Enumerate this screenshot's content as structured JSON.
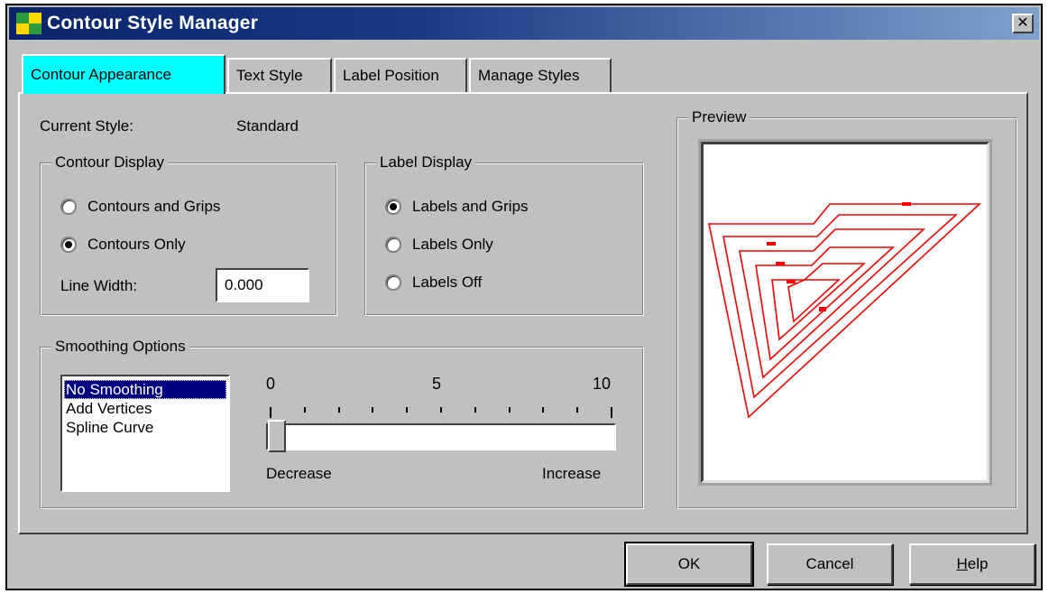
{
  "window": {
    "title": "Contour Style Manager",
    "close_label": "✕"
  },
  "tabs": [
    {
      "label": "Contour Appearance",
      "active": true
    },
    {
      "label": "Text Style",
      "active": false
    },
    {
      "label": "Label Position",
      "active": false
    },
    {
      "label": "Manage Styles",
      "active": false
    }
  ],
  "current_style": {
    "label": "Current Style:",
    "value": "Standard"
  },
  "contour_display": {
    "title": "Contour Display",
    "options": [
      {
        "label": "Contours and Grips",
        "checked": false
      },
      {
        "label": "Contours Only",
        "checked": true
      }
    ],
    "line_width_label": "Line Width:",
    "line_width_value": "0.000"
  },
  "label_display": {
    "title": "Label Display",
    "options": [
      {
        "label": "Labels and Grips",
        "checked": true
      },
      {
        "label": "Labels Only",
        "checked": false
      },
      {
        "label": "Labels Off",
        "checked": false
      }
    ]
  },
  "smoothing": {
    "title": "Smoothing Options",
    "list": [
      {
        "label": "No Smoothing",
        "selected": true
      },
      {
        "label": "Add Vertices",
        "selected": false
      },
      {
        "label": "Spline Curve",
        "selected": false
      }
    ],
    "scale": {
      "min": "0",
      "mid": "5",
      "max": "10"
    },
    "slider_value": 0,
    "decrease_label": "Decrease",
    "increase_label": "Increase"
  },
  "preview": {
    "title": "Preview",
    "line_color": "#ff0000"
  },
  "buttons": {
    "ok": "OK",
    "cancel": "Cancel",
    "help": "Help"
  },
  "icons": {
    "app": "contour-app-icon",
    "close": "close-icon"
  }
}
